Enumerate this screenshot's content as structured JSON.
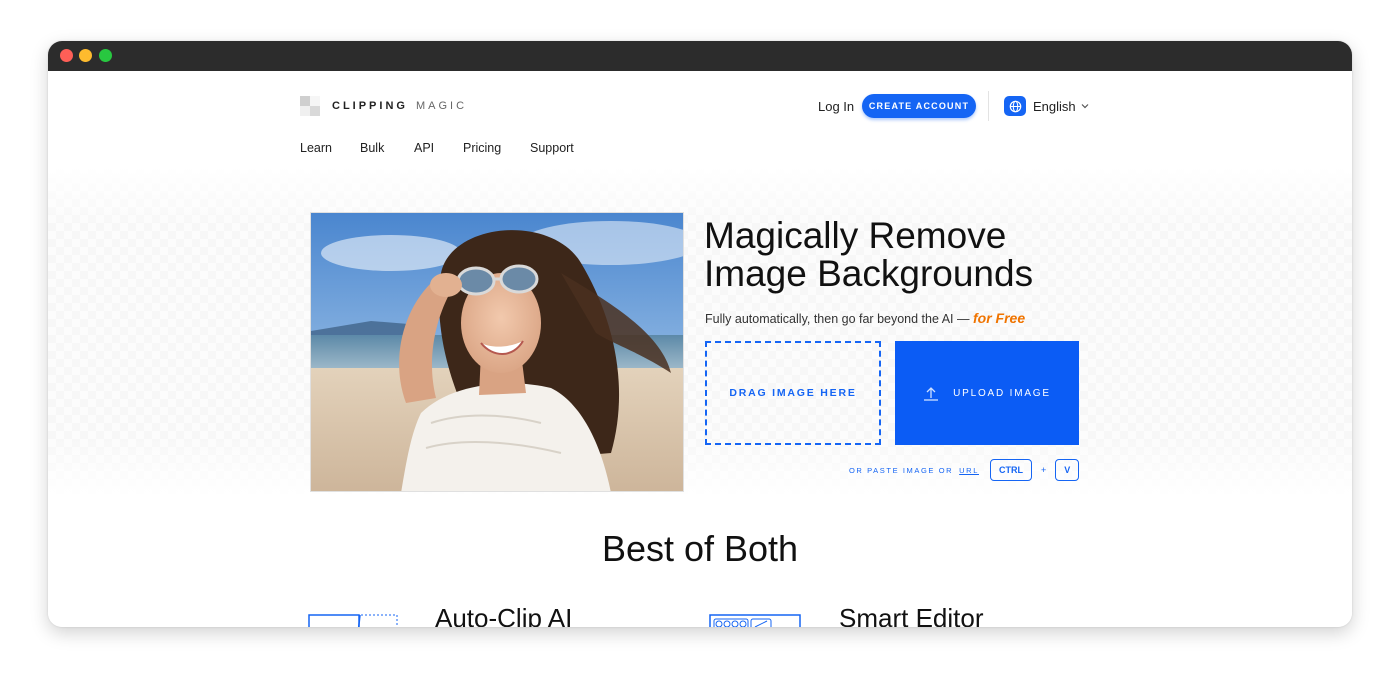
{
  "header": {
    "logo_primary": "CLIPPING",
    "logo_secondary": "MAGIC",
    "login_label": "Log In",
    "create_account_label": "CREATE ACCOUNT",
    "language_label": "English",
    "language_icon": "globe-icon"
  },
  "nav": {
    "items": [
      {
        "label": "Learn"
      },
      {
        "label": "Bulk"
      },
      {
        "label": "API"
      },
      {
        "label": "Pricing"
      },
      {
        "label": "Support"
      }
    ]
  },
  "hero": {
    "title_line1": "Magically Remove",
    "title_line2": "Image Backgrounds",
    "subtitle": "Fully automatically, then go far beyond the AI —",
    "subtitle_highlight": "for Free",
    "drag_label": "DRAG IMAGE HERE",
    "upload_label": "UPLOAD IMAGE",
    "upload_icon": "upload-icon",
    "paste_text": "OR PASTE IMAGE OR",
    "paste_url_label": "URL",
    "key_ctrl": "CTRL",
    "key_plus": "+",
    "key_v": "V"
  },
  "section": {
    "title": "Best of Both"
  },
  "features": [
    {
      "title": "Auto-Clip AI"
    },
    {
      "title": "Smart Editor"
    }
  ],
  "colors": {
    "accent": "#1565f4",
    "highlight": "#f07400",
    "titlebar": "#2c2c2c"
  }
}
